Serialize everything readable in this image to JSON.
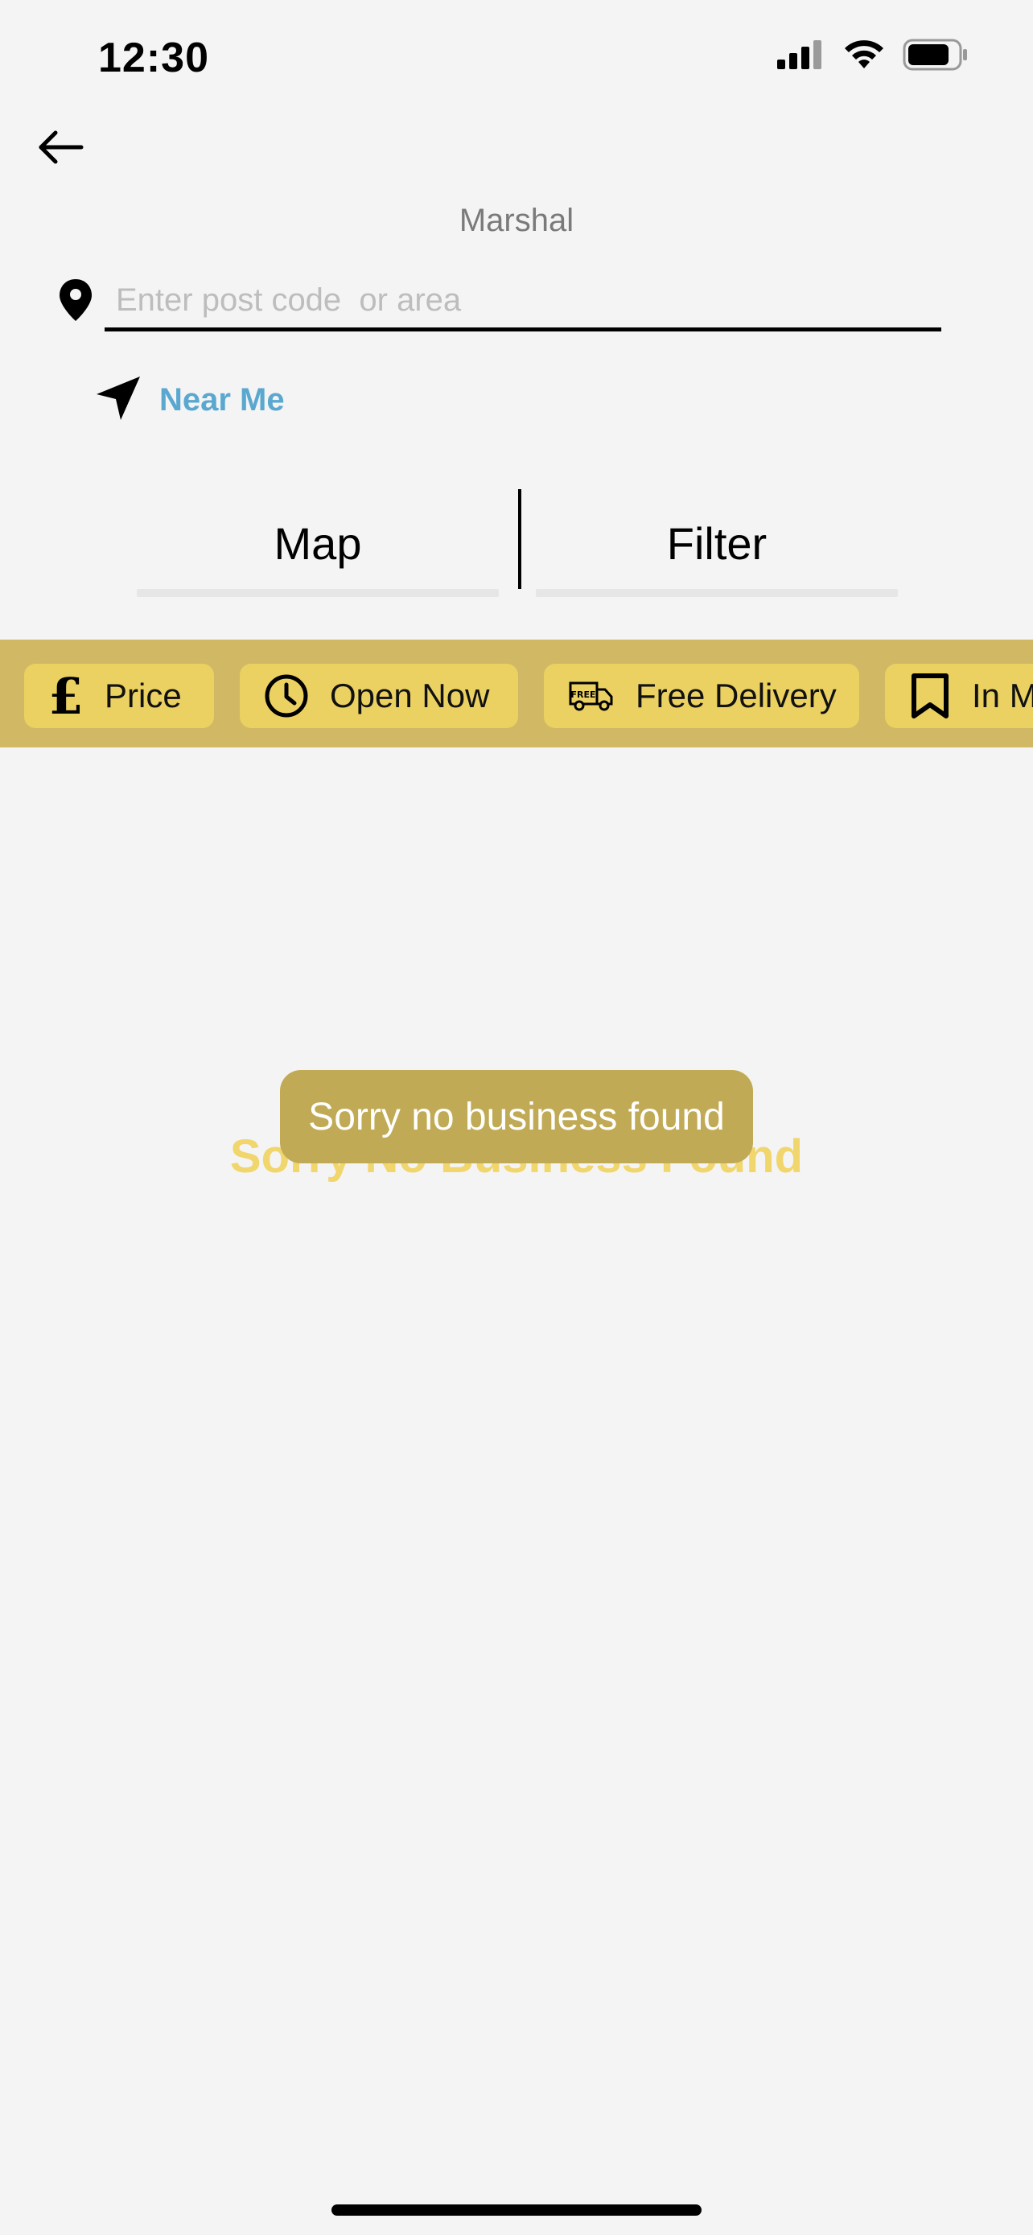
{
  "status_bar": {
    "time": "12:30",
    "icons": [
      "signal-icon",
      "wifi-icon",
      "battery-icon"
    ]
  },
  "header": {
    "back_icon": "arrow-left-icon",
    "location_title": "Marshal"
  },
  "search": {
    "placeholder": "Enter post code  or area",
    "value": "",
    "icon": "location-pin-icon"
  },
  "near_me": {
    "label": "Near Me",
    "icon": "navigation-arrow-icon"
  },
  "tabs": [
    {
      "label": "Map"
    },
    {
      "label": "Filter"
    }
  ],
  "filters": [
    {
      "label": "Price",
      "icon": "pound-icon"
    },
    {
      "label": "Open Now",
      "icon": "clock-icon"
    },
    {
      "label": "Free Delivery",
      "icon": "delivery-truck-icon"
    },
    {
      "label": "In M",
      "icon": "bookmark-icon"
    }
  ],
  "empty_state": {
    "message": "Sorry No Business Found"
  },
  "toast": {
    "message": "Sorry no business found"
  },
  "colors": {
    "background": "#f4f4f4",
    "filter_strip": "#d1b864",
    "chip": "#ebd161",
    "near_me": "#5aa8d0",
    "toast": "#c1aa55",
    "empty_text": "#f1d66e"
  }
}
